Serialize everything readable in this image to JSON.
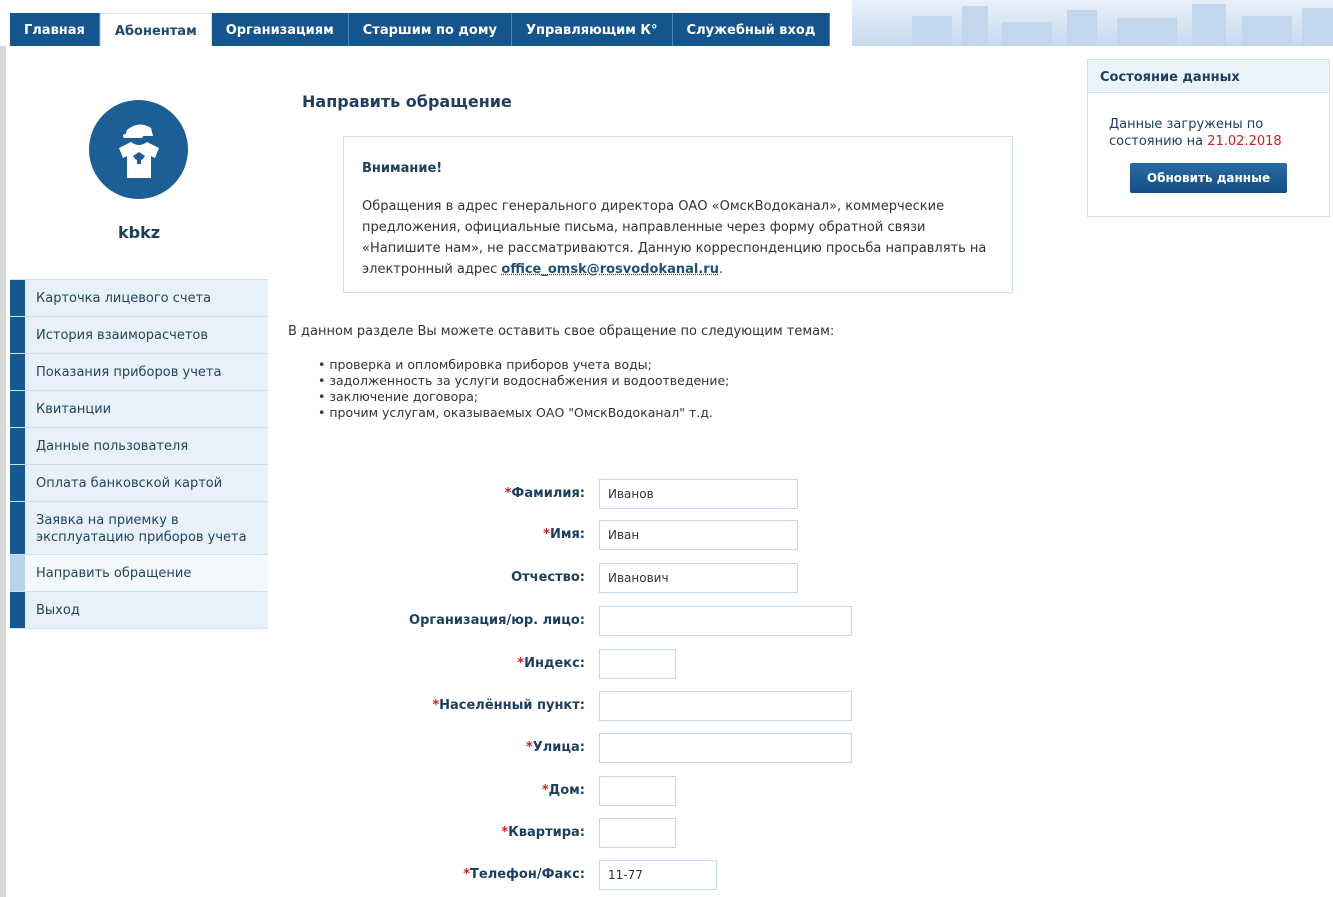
{
  "nav": {
    "tabs": [
      {
        "label": "Главная",
        "active": false
      },
      {
        "label": "Абонентам",
        "active": true
      },
      {
        "label": "Организациям",
        "active": false
      },
      {
        "label": "Старшим по дому",
        "active": false
      },
      {
        "label": "Управляющим К°",
        "active": false
      },
      {
        "label": "Служебный вход",
        "active": false
      }
    ]
  },
  "profile": {
    "username": "kbkz",
    "avatar_icon": "user-tshirt-icon"
  },
  "sidebar": {
    "items": [
      {
        "label": "Карточка лицевого счета"
      },
      {
        "label": "История взаиморасчетов"
      },
      {
        "label": "Показания приборов учета"
      },
      {
        "label": "Квитанции"
      },
      {
        "label": "Данные пользователя"
      },
      {
        "label": "Оплата банковской картой"
      },
      {
        "label": "Заявка на приемку в эксплуатацию приборов учета"
      },
      {
        "label": "Направить обращение",
        "active": true
      },
      {
        "label": "Выход"
      }
    ]
  },
  "main": {
    "title": "Направить обращение",
    "notice": {
      "title": "Внимание!",
      "text": "Обращения в адрес генерального директора ОАО «ОмскВодоканал», коммерческие предложения, официальные письма, направленные через форму обратной связи «Напишите нам», не рассматриваются. Данную корреспонденцию просьба направлять на электронный адрес ",
      "email": "office_omsk@rosvodokanal.ru",
      "tail": "."
    },
    "intro": "В данном разделе Вы можете оставить свое обращение по следующим темам:",
    "topics": [
      "проверка и опломбировка приборов учета воды;",
      "задолженность за услуги водоснабжения и водоотведение;",
      "заключение договора;",
      "прочим услугам, оказываемых ОАО \"ОмскВодоканал\" т.д."
    ]
  },
  "form": {
    "required_mark": "*",
    "surname": {
      "label": "Фамилия:",
      "value": "Иванов"
    },
    "name": {
      "label": "Имя:",
      "value": "Иван"
    },
    "patronymic": {
      "label": "Отчество:",
      "value": "Иванович"
    },
    "organization": {
      "label": "Организация/юр. лицо:",
      "value": ""
    },
    "index": {
      "label": "Индекс:",
      "value": ""
    },
    "locality": {
      "label": "Населённый пункт:",
      "value": ""
    },
    "street": {
      "label": "Улица:",
      "value": ""
    },
    "house": {
      "label": "Дом:",
      "value": ""
    },
    "apartment": {
      "label": "Квартира:",
      "value": ""
    },
    "phone": {
      "label": "Телефон/Факс:",
      "value": "11-77"
    }
  },
  "status_panel": {
    "title": "Состояние данных",
    "text": "Данные загружены по состоянию на ",
    "date": "21.02.2018",
    "button": "Обновить данные"
  },
  "colors": {
    "nav_blue": "#13558c",
    "required_red": "#d11d1d",
    "heading_blue": "#1d3e5f"
  }
}
